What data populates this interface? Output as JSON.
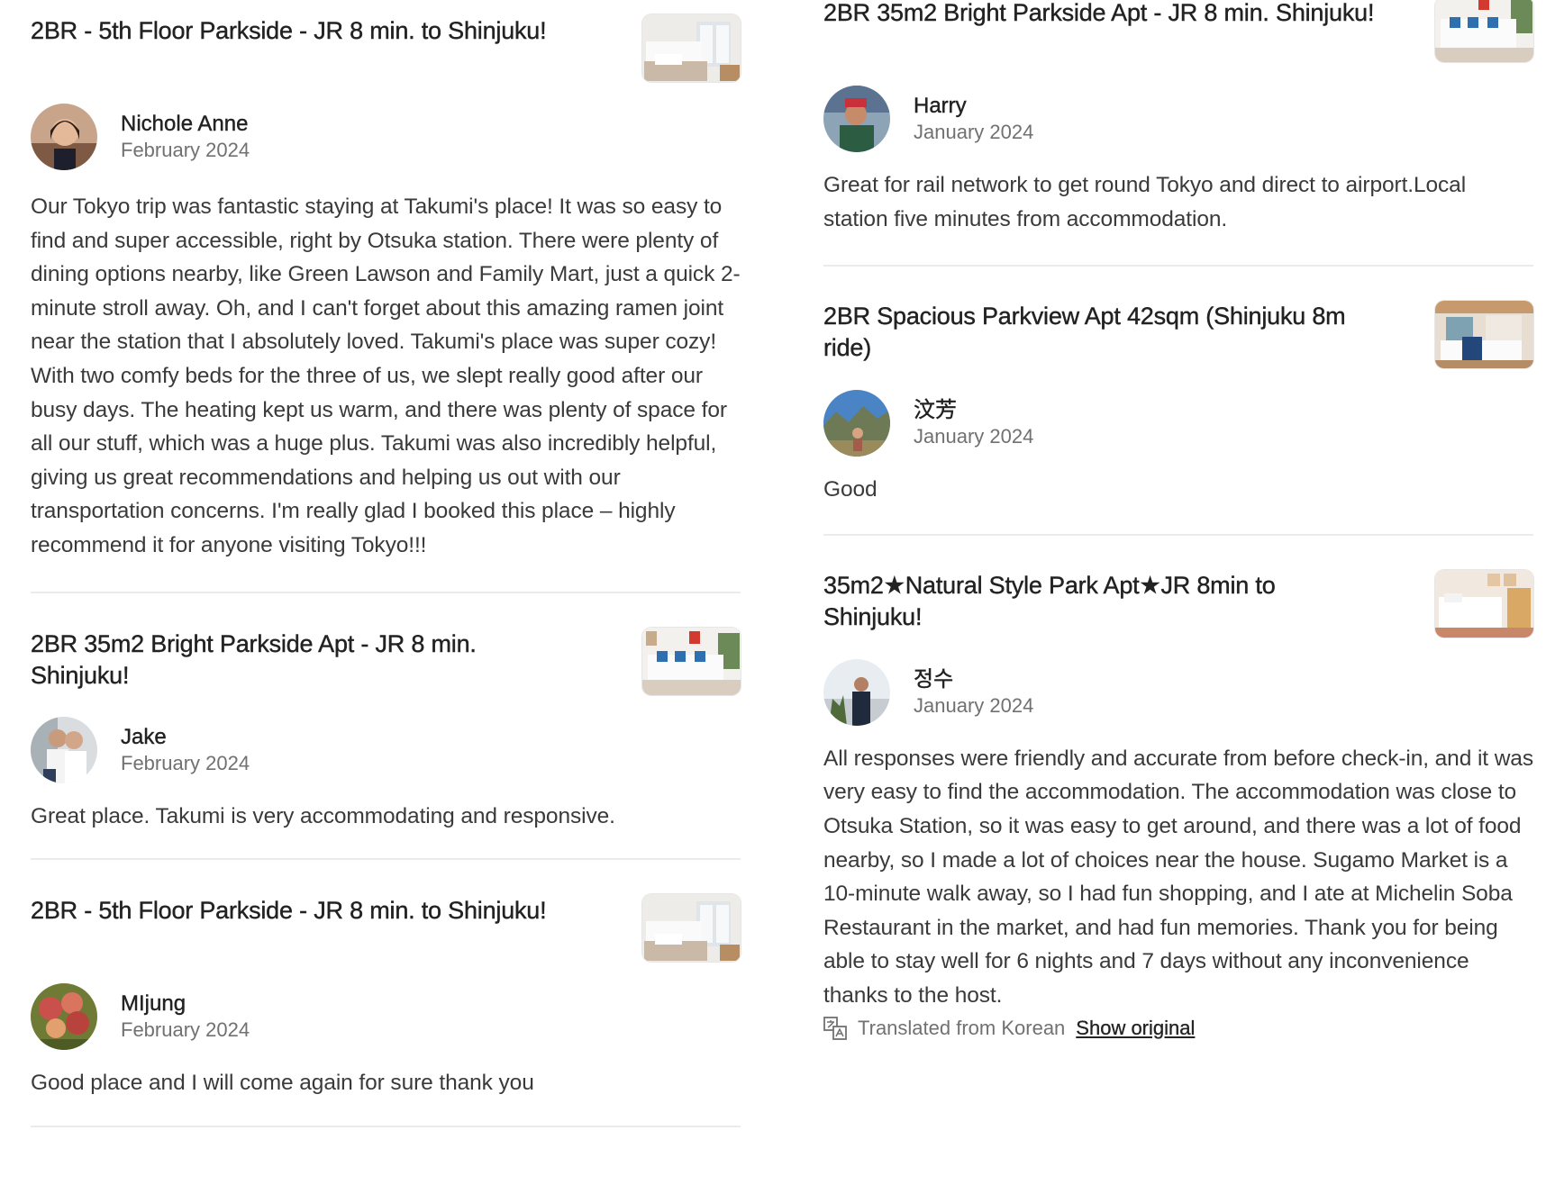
{
  "left_column": {
    "reviews": [
      {
        "listing_title": "2BR - 5th Floor Parkside - JR 8 min. to Shinjuku!",
        "reviewer_name": "Nichole Anne",
        "date": "February 2024",
        "text": "Our Tokyo trip was fantastic staying at Takumi's place! It was so easy to find and super accessible, right by Otsuka station. There were plenty of dining options nearby, like Green Lawson and Family Mart, just a quick 2-minute stroll away. Oh, and I can't forget about this amazing ramen joint near the station that I absolutely loved. Takumi's place was super cozy! With two comfy beds for the three of us, we slept really good after our busy days. The heating kept us warm, and there was plenty of space for all our stuff, which was a huge plus. Takumi was also incredibly helpful, giving us great recommendations and helping us out with our transportation concerns. I'm really glad I booked this place – highly recommend it for anyone visiting Tokyo!!!"
      },
      {
        "listing_title": "2BR 35m2 Bright Parkside Apt - JR 8 min. Shinjuku!",
        "reviewer_name": "Jake",
        "date": "February 2024",
        "text": "Great place. Takumi is very accommodating and responsive."
      },
      {
        "listing_title": "2BR - 5th Floor Parkside - JR 8 min. to Shinjuku!",
        "reviewer_name": "MIjung",
        "date": "February 2024",
        "text": "Good place and I will come again for sure thank you"
      }
    ]
  },
  "right_column": {
    "reviews": [
      {
        "listing_title": "2BR 35m2 Bright Parkside Apt - JR 8 min. Shinjuku!",
        "reviewer_name": "Harry",
        "date": "January 2024",
        "text": "Great for rail network to get round Tokyo and direct to airport.Local station five minutes from accommodation."
      },
      {
        "listing_title": "2BR Spacious Parkview Apt 42sqm (Shinjuku 8m ride)",
        "reviewer_name": "汶芳",
        "date": "January 2024",
        "text": "Good"
      },
      {
        "listing_title": "35m2★Natural Style Park Apt★JR 8min to Shinjuku!",
        "reviewer_name": "정수",
        "date": "January 2024",
        "text": "All responses were friendly and accurate from before check-in, and it was very easy to find the accommodation. The accommodation was close to Otsuka Station, so it was easy to get around, and there was a lot of food nearby, so I made a lot of choices near the house. Sugamo Market is a 10-minute walk away, so I had fun shopping, and I ate at Michelin Soba Restaurant in the market, and had fun memories. Thank you for being able to stay well for 6 nights and 7 days without any inconvenience thanks to the host.",
        "translated_label": "Translated from Korean",
        "show_original_label": "Show original"
      }
    ]
  },
  "icons": {
    "translate": "translate-icon"
  },
  "colors": {
    "text_primary": "#222222",
    "text_secondary": "#717171",
    "divider": "#ebebeb"
  }
}
